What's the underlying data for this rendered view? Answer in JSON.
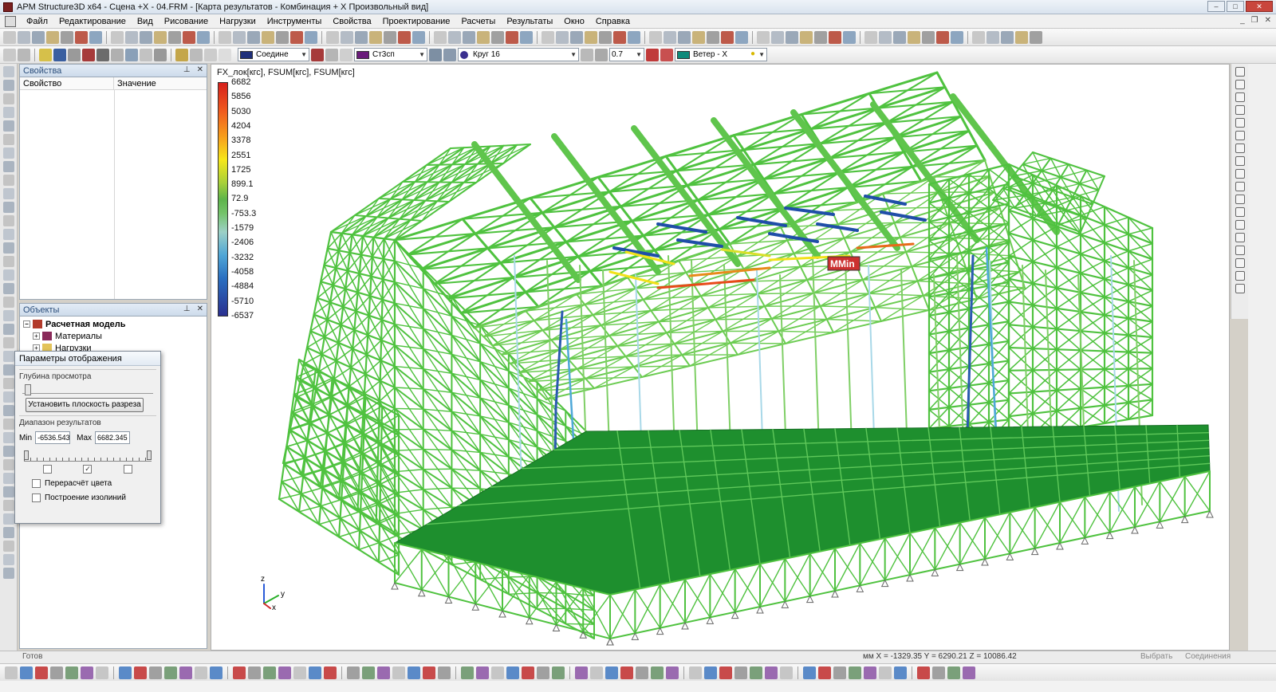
{
  "window": {
    "title": "APM Structure3D x64 - Сцена +X - 04.FRM - [Карта результатов - Комбинация + X Произвольный вид]"
  },
  "menu": [
    "Файл",
    "Редактирование",
    "Вид",
    "Рисование",
    "Нагрузки",
    "Инструменты",
    "Свойства",
    "Проектирование",
    "Расчеты",
    "Результаты",
    "Окно",
    "Справка"
  ],
  "toolbar2": {
    "connection_combo": "Соедине",
    "material_combo": "Ст3сп",
    "section_combo": "Круг 16",
    "scale_combo": "0.7",
    "load_combo": "Ветер - X"
  },
  "colors": {
    "connection_swatch": "#1f2f7a",
    "material_swatch": "#6a1b7a",
    "load_swatch": "#0f8a7a",
    "structure_green": "#4fc23f",
    "slab_green": "#1e8f2e"
  },
  "properties_panel": {
    "title": "Свойства",
    "col_property": "Свойство",
    "col_value": "Значение"
  },
  "objects_panel": {
    "title": "Объекты",
    "tree": [
      {
        "label": "Расчетная модель",
        "bold": true,
        "indent": 0
      },
      {
        "label": "Материалы",
        "bold": false,
        "indent": 1
      },
      {
        "label": "Нагрузки",
        "bold": false,
        "indent": 1
      }
    ]
  },
  "display_dialog": {
    "title": "Параметры отображения",
    "depth_label": "Глубина просмотра",
    "depth_level": 0.02,
    "section_button": "Установить плоскость разреза",
    "range_label": "Диапазон результатов",
    "min_label": "Min",
    "min_value": "-6536.543",
    "max_label": "Max",
    "max_value": "6682.345",
    "checkboxes": [
      false,
      true,
      false
    ],
    "recalc_colors": "Перерасчёт цвета",
    "isolines": "Построение изолиний"
  },
  "viewport": {
    "title": "FX_лок[кгс], FSUM[кгс], FSUM[кгс]",
    "legend": [
      "6682",
      "5856",
      "5030",
      "4204",
      "3378",
      "2551",
      "1725",
      "899.1",
      "72.9",
      "-753.3",
      "-1579",
      "-2406",
      "-3232",
      "-4058",
      "-4884",
      "-5710",
      "-6537"
    ],
    "marker_label": "MMin",
    "axis_z": "z",
    "axis_y": "y",
    "axis_x": "x"
  },
  "status": {
    "ready": "Готов",
    "coords": "мм X = -1329.35 Y = 6290.21 Z = 10086.42",
    "select": "Выбрать",
    "connections": "Соединения"
  }
}
